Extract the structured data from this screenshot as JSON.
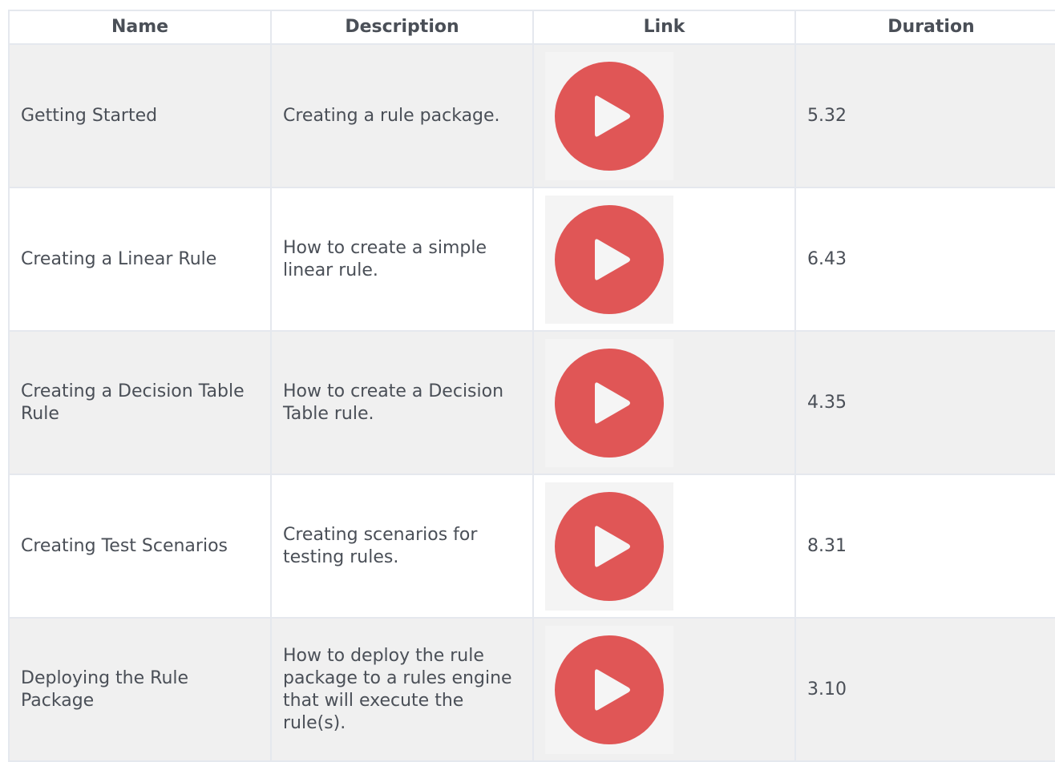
{
  "table": {
    "headers": {
      "name": "Name",
      "description": "Description",
      "link": "Link",
      "duration": "Duration"
    },
    "rows": [
      {
        "name": "Getting Started",
        "description": "Creating a rule package.",
        "link_icon": "play-video-icon",
        "duration": "5.32"
      },
      {
        "name": "Creating a Linear Rule",
        "description": "How to create a simple linear rule.",
        "link_icon": "play-video-icon",
        "duration": "6.43"
      },
      {
        "name": "Creating a Decision Table Rule",
        "description": "How to create a Decision Table rule.",
        "link_icon": "play-video-icon",
        "duration": "4.35"
      },
      {
        "name": "Creating Test Scenarios",
        "description": "Creating scenarios for testing rules.",
        "link_icon": "play-video-icon",
        "duration": "8.31"
      },
      {
        "name": "Deploying the Rule Package",
        "description": "How to deploy the rule package to a rules engine that will execute the rule(s).",
        "link_icon": "play-video-icon",
        "duration": "3.10"
      }
    ]
  },
  "colors": {
    "play_red": "#e05656",
    "play_white": "#f5f5f5",
    "row_alt": "#f0f0f0",
    "border": "#e5e8ee",
    "text": "#4a4f57"
  }
}
